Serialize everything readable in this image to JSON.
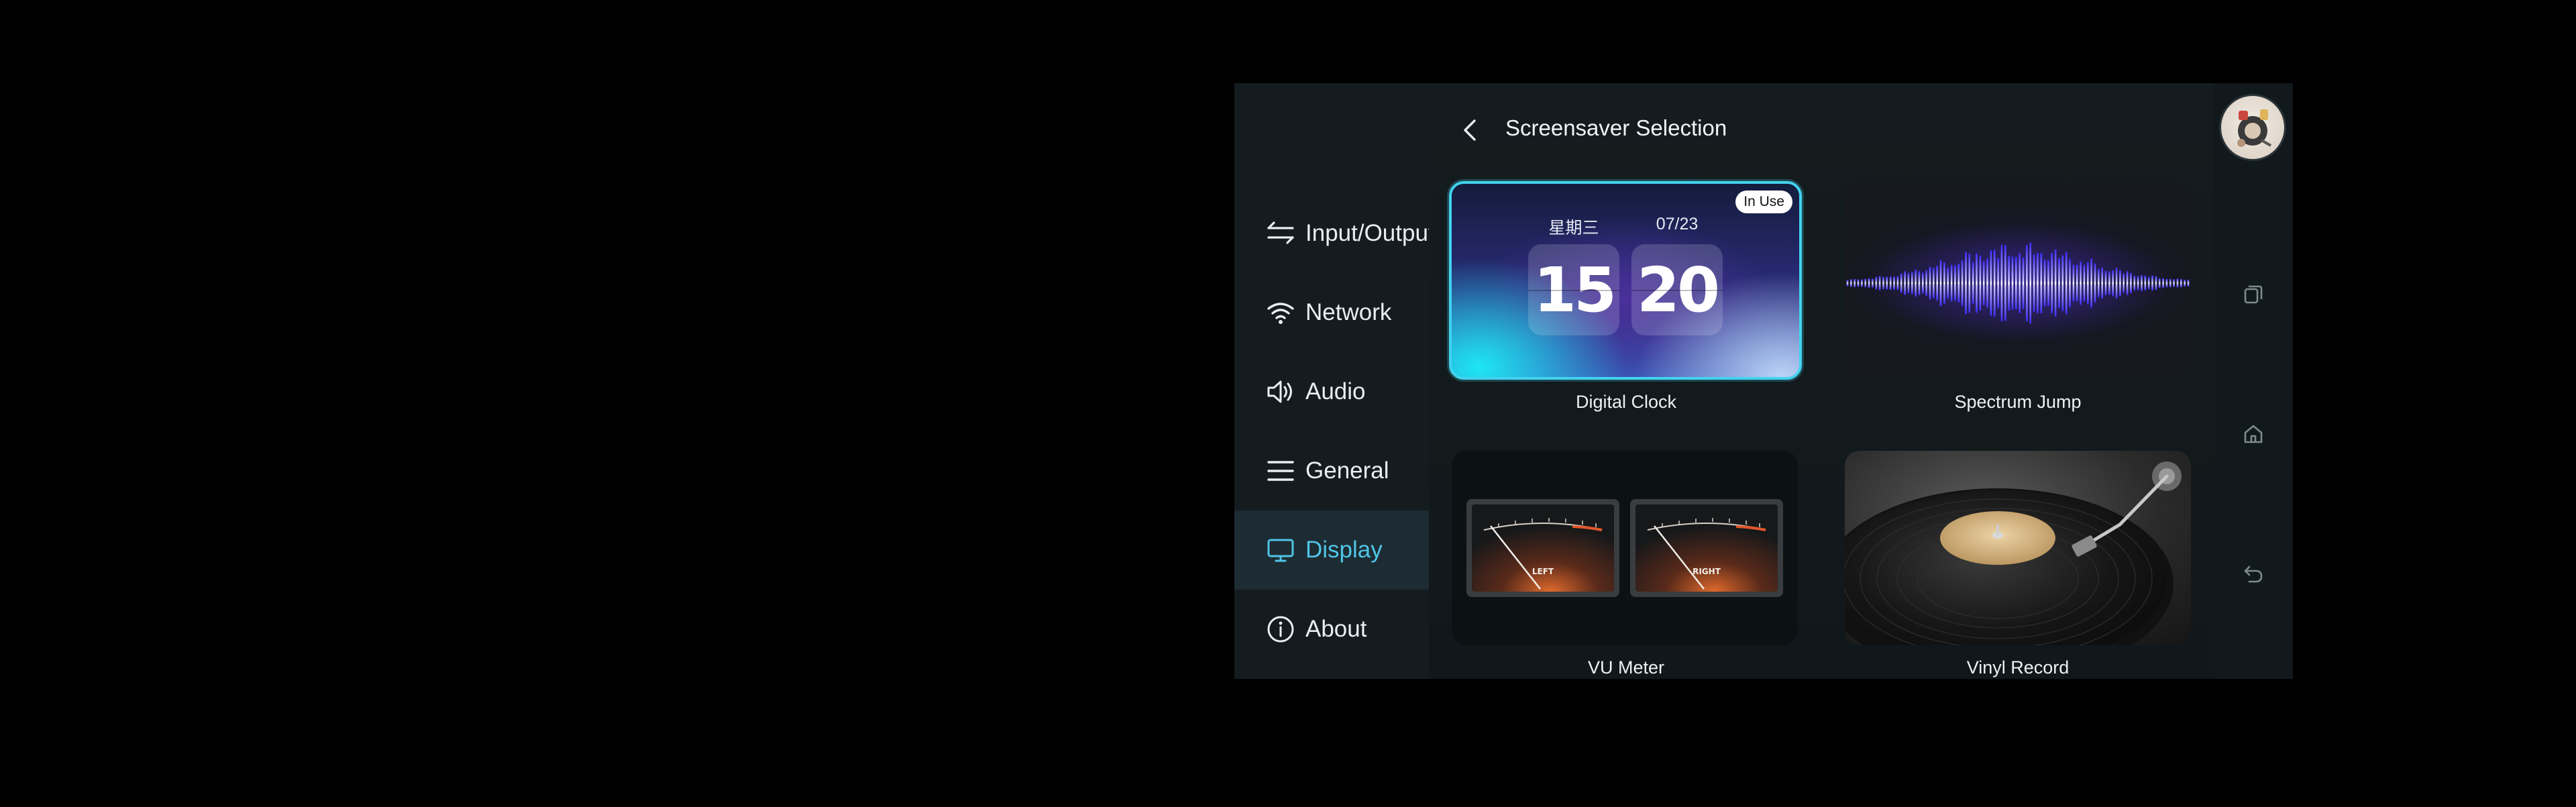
{
  "sidebar": {
    "items": [
      {
        "label": "Input/Output",
        "icon": "swap-arrows-icon",
        "active": false
      },
      {
        "label": "Network",
        "icon": "wifi-icon",
        "active": false
      },
      {
        "label": "Audio",
        "icon": "speaker-icon",
        "active": false
      },
      {
        "label": "General",
        "icon": "menu-lines-icon",
        "active": false
      },
      {
        "label": "Display",
        "icon": "monitor-icon",
        "active": true
      },
      {
        "label": "About",
        "icon": "info-icon",
        "active": false
      }
    ]
  },
  "header": {
    "title": "Screensaver Selection",
    "back_icon": "chevron-left-icon"
  },
  "screensavers": [
    {
      "label": "Digital Clock",
      "in_use": true,
      "badge": "In Use",
      "weekday": "星期三",
      "date": "07/23",
      "hour": "15",
      "minute": "20"
    },
    {
      "label": "Spectrum Jump",
      "in_use": false
    },
    {
      "label": "VU Meter",
      "in_use": false,
      "left_label": "LEFT",
      "right_label": "RIGHT"
    },
    {
      "label": "Vinyl Record",
      "in_use": false
    }
  ],
  "rail": {
    "avatar": "avatar",
    "buttons": [
      "recent-apps-icon",
      "home-icon",
      "back-arrow-icon"
    ]
  },
  "colors": {
    "accent": "#4fc5e6",
    "active_bg": "#1d2b33",
    "selected_border": "#43d2ee"
  }
}
